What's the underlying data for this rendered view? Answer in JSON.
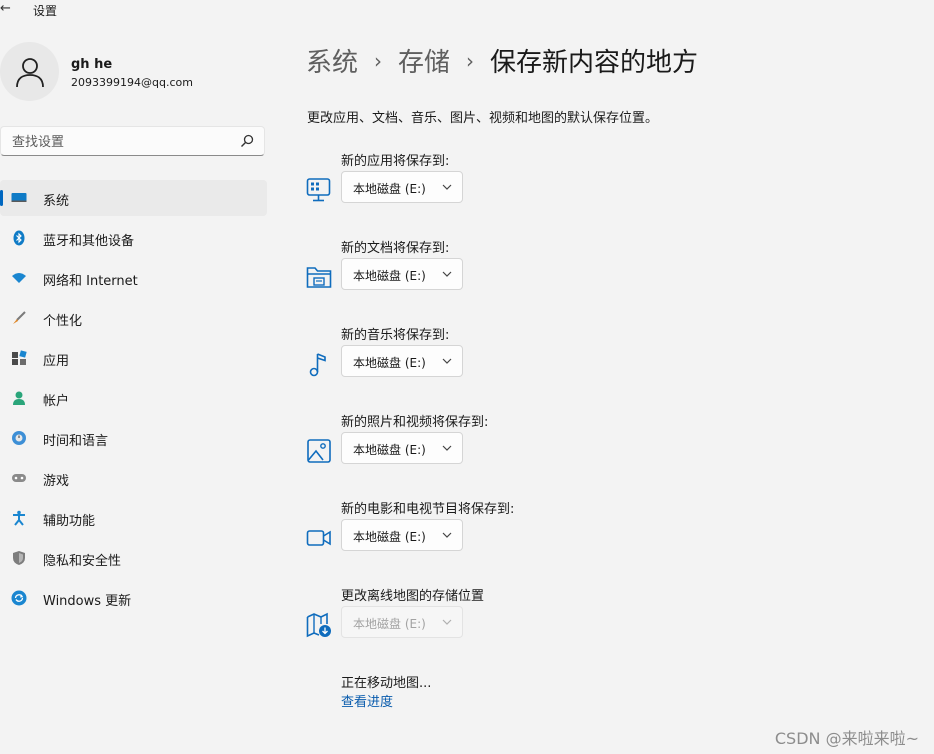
{
  "window": {
    "title": "设置"
  },
  "profile": {
    "name": "gh he",
    "email": "2093399194@qq.com"
  },
  "search": {
    "placeholder": "查找设置"
  },
  "sidebar": {
    "items": [
      {
        "label": "系统",
        "icon": "monitor-icon",
        "active": true
      },
      {
        "label": "蓝牙和其他设备",
        "icon": "bluetooth-icon"
      },
      {
        "label": "网络和 Internet",
        "icon": "wifi-icon"
      },
      {
        "label": "个性化",
        "icon": "brush-icon"
      },
      {
        "label": "应用",
        "icon": "apps-icon"
      },
      {
        "label": "帐户",
        "icon": "account-icon"
      },
      {
        "label": "时间和语言",
        "icon": "globe-clock-icon"
      },
      {
        "label": "游戏",
        "icon": "gamepad-icon"
      },
      {
        "label": "辅助功能",
        "icon": "accessibility-icon"
      },
      {
        "label": "隐私和安全性",
        "icon": "shield-icon"
      },
      {
        "label": "Windows 更新",
        "icon": "update-icon"
      }
    ]
  },
  "breadcrumb": {
    "level1": "系统",
    "level2": "存储",
    "current": "保存新内容的地方"
  },
  "main": {
    "description": "更改应用、文档、音乐、图片、视频和地图的默认保存位置。",
    "settings": [
      {
        "label": "新的应用将保存到:",
        "value": "本地磁盘 (E:)",
        "icon": "apps-save-icon"
      },
      {
        "label": "新的文档将保存到:",
        "value": "本地磁盘 (E:)",
        "icon": "folder-icon"
      },
      {
        "label": "新的音乐将保存到:",
        "value": "本地磁盘 (E:)",
        "icon": "music-note-icon"
      },
      {
        "label": "新的照片和视频将保存到:",
        "value": "本地磁盘 (E:)",
        "icon": "photo-icon"
      },
      {
        "label": "新的电影和电视节目将保存到:",
        "value": "本地磁盘 (E:)",
        "icon": "video-camera-icon"
      },
      {
        "label": "更改离线地图的存储位置",
        "value": "本地磁盘 (E:)",
        "icon": "map-download-icon",
        "disabled": true
      }
    ],
    "moving_text": "正在移动地图...",
    "progress_link": "查看进度"
  },
  "watermark": "CSDN @来啦来啦~",
  "colors": {
    "accent": "#0067c0",
    "background": "#f3f3f3",
    "link": "#0a5cad"
  }
}
